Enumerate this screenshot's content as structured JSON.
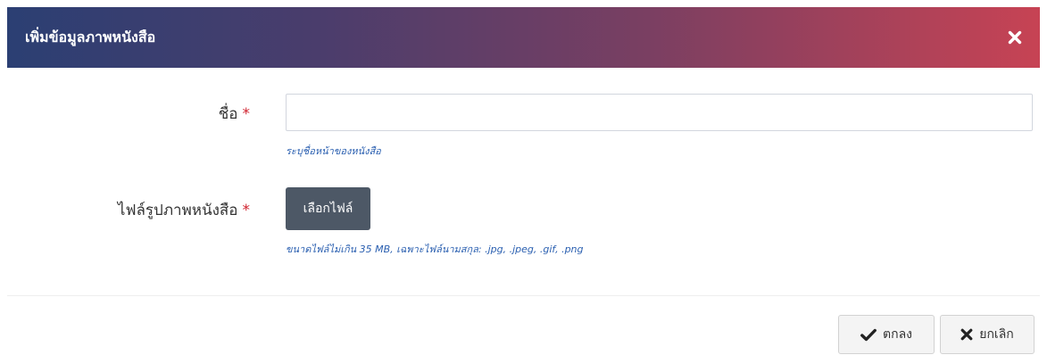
{
  "modal": {
    "title": "เพิ่มข้อมูลภาพหนังสือ"
  },
  "form": {
    "name": {
      "label": "ชื่อ",
      "required_mark": "*",
      "value": "",
      "help": "ระบุชื่อหน้าของหนังสือ"
    },
    "image_file": {
      "label": "ไฟล์รูปภาพหนังสือ",
      "required_mark": "*",
      "button_label": "เลือกไฟล์",
      "help": "ขนาดไฟล์ไม่เกิน 35 MB, เฉพาะไฟล์นามสกุล: .jpg, .jpeg, .gif, .png"
    }
  },
  "footer": {
    "ok_label": "ตกลง",
    "cancel_label": "ยกเลิก"
  },
  "icons": {
    "close": "close-icon",
    "ok": "check-icon",
    "cancel": "times-icon"
  },
  "colors": {
    "header_gradient_start": "#2b3f73",
    "header_gradient_end": "#c74354",
    "required": "#d0222e",
    "help_text": "#2a5fb0",
    "choose_button": "#4d5866"
  }
}
